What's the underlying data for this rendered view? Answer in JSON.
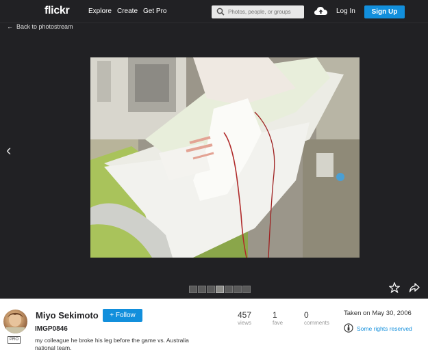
{
  "header": {
    "logo": "flickr",
    "nav": [
      "Explore",
      "Create",
      "Get Pro"
    ],
    "search_placeholder": "Photos, people, or groups",
    "login_label": "Log In",
    "signup_label": "Sign Up"
  },
  "back_label": "Back to photostream",
  "photo": {
    "title": "IMGP0846",
    "description": "my colleague he broke his leg before the game vs. Australia national team."
  },
  "owner": {
    "name": "Miyo Sekimoto",
    "badge": "PRO",
    "follow_label": "+ Follow"
  },
  "stats": {
    "views": {
      "value": "457",
      "label": "views"
    },
    "faves": {
      "value": "1",
      "label": "fave"
    },
    "comments": {
      "value": "0",
      "label": "comments"
    }
  },
  "taken": "Taken on May 30, 2006",
  "license": "Some rights reserved",
  "icons": [
    "search-icon",
    "upload-cloud-icon",
    "back-arrow-icon",
    "prev-chevron-icon",
    "favorite-star-icon",
    "share-arrow-icon",
    "license-icon"
  ],
  "colors": {
    "accent": "#128fdc",
    "dark_bg": "#212124"
  }
}
